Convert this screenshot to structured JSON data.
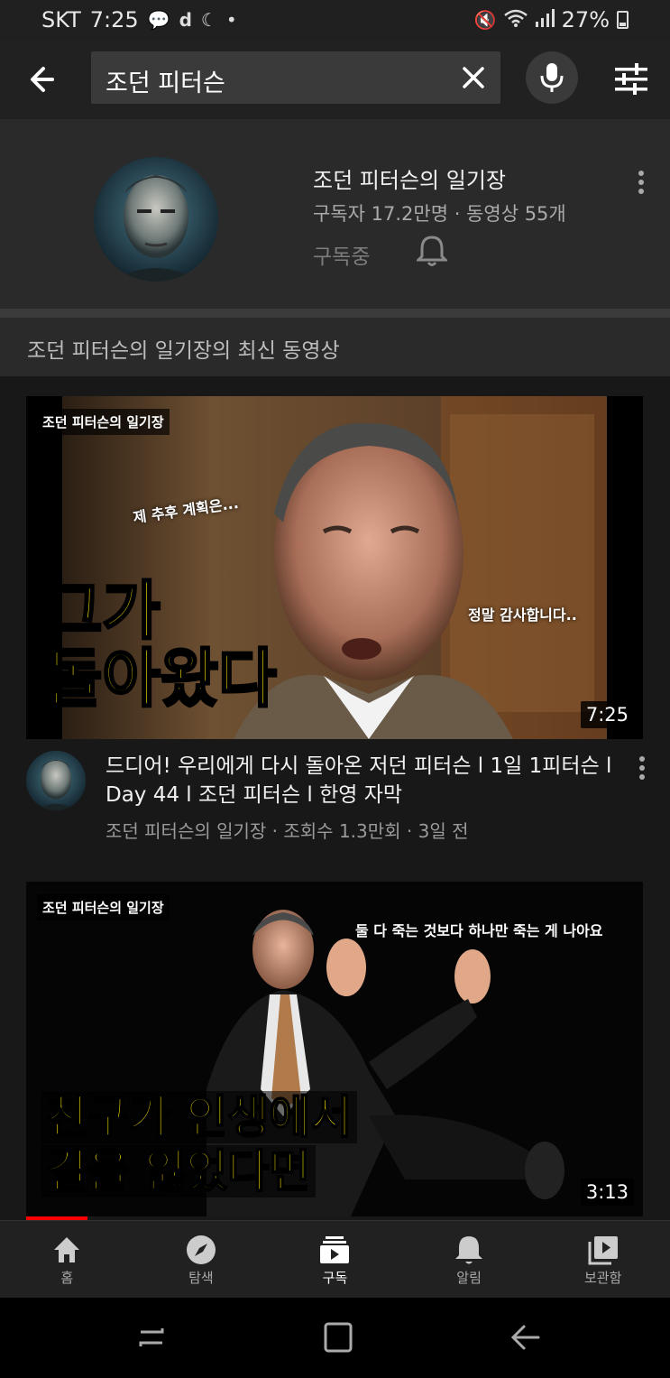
{
  "status_bar": {
    "carrier": "SKT",
    "time": "7:25",
    "battery": "27%",
    "icons": [
      "talk-icon",
      "d-icon",
      "moon-icon",
      "dot",
      "mute-icon",
      "wifi-icon",
      "signal-icon",
      "battery-icon"
    ]
  },
  "search": {
    "query": "조던 피터슨",
    "icons": [
      "back-arrow-icon",
      "close-icon",
      "mic-icon",
      "filter-icon"
    ]
  },
  "channel": {
    "name": "조던 피터슨의 일기장",
    "stats": "구독자 17.2만명 · 동영상 55개",
    "subscribe_state": "구독중"
  },
  "section": {
    "title": "조던 피터슨의 일기장의 최신 동영상"
  },
  "videos": [
    {
      "thumb_channel": "조던 피터슨의 일기장",
      "thumb_caption1": "제 추후 계획은...",
      "thumb_caption2": "정말 감사합니다..",
      "thumb_big_line1": "그가",
      "thumb_big_line2": "돌아왔다",
      "duration": "7:25",
      "title": "드디어! 우리에게 다시 돌아온 저던 피터슨 l  1일 1피터슨  l  Day 44 l 조던 피터슨  l  한영 자막",
      "meta": "조던 피터슨의 일기장 · 조회수 1.3만회 · 3일 전"
    },
    {
      "thumb_channel": "조던 피터슨의 일기장",
      "thumb_caption1": "둘 다 죽는 것보다 하나만 죽는 게 나아요",
      "thumb_big_line1": "친구가 인생에서",
      "thumb_big_line2": "길을 잃었다면",
      "duration": "3:13",
      "watched_fraction": 0.1
    }
  ],
  "bottom_nav": {
    "items": [
      {
        "label": "홈",
        "icon": "home-icon"
      },
      {
        "label": "탐색",
        "icon": "compass-icon"
      },
      {
        "label": "구독",
        "icon": "subscriptions-icon",
        "active": true
      },
      {
        "label": "알림",
        "icon": "bell-icon"
      },
      {
        "label": "보관함",
        "icon": "library-icon"
      }
    ]
  },
  "colors": {
    "background": "#181818",
    "card": "#2a2a2a",
    "accent": "#ff0000",
    "thumb_text": "#ffe600"
  }
}
